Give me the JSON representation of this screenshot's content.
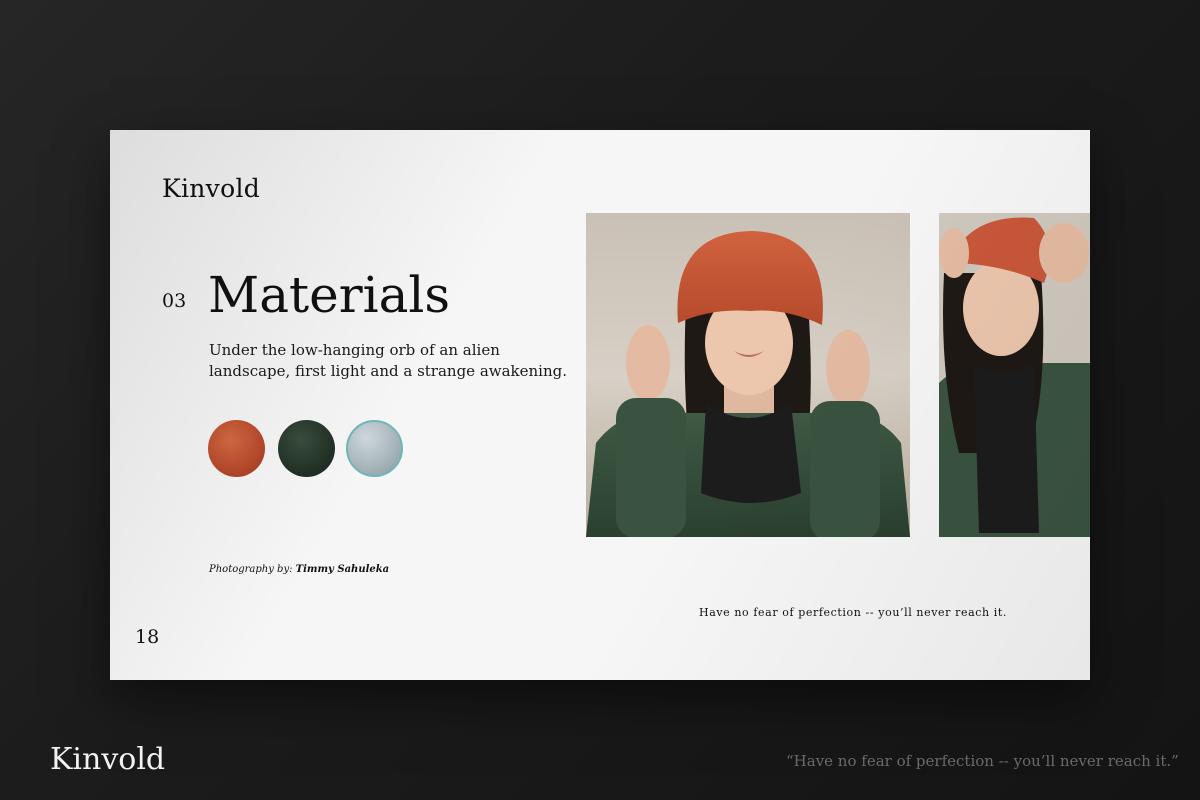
{
  "slide": {
    "brand": "Kinvold",
    "section_number": "03",
    "section_title": "Materials",
    "section_text": "Under the low-hanging orb of an alien landscape, first light and a strange awakening.",
    "swatches": [
      {
        "name": "orange-knit",
        "color": "#c4553a"
      },
      {
        "name": "green-knit",
        "color": "#2a3a2f"
      },
      {
        "name": "silver-fabric",
        "color": "#b7c3c8"
      }
    ],
    "credit_prefix": "Photography by:",
    "credit_name": "Timmy Sahuleka",
    "quote": "Have no fear of perfection -- you’ll never reach it.",
    "page_number": "18"
  },
  "footer": {
    "brand": "Kinvold",
    "quote": "“Have no fear of perfection -- you’ll never reach it.”"
  },
  "colors": {
    "background": "#1b1b1b",
    "slide": "#f6f6f6",
    "accent_orange": "#c4553a",
    "accent_green": "#2f4a38"
  }
}
